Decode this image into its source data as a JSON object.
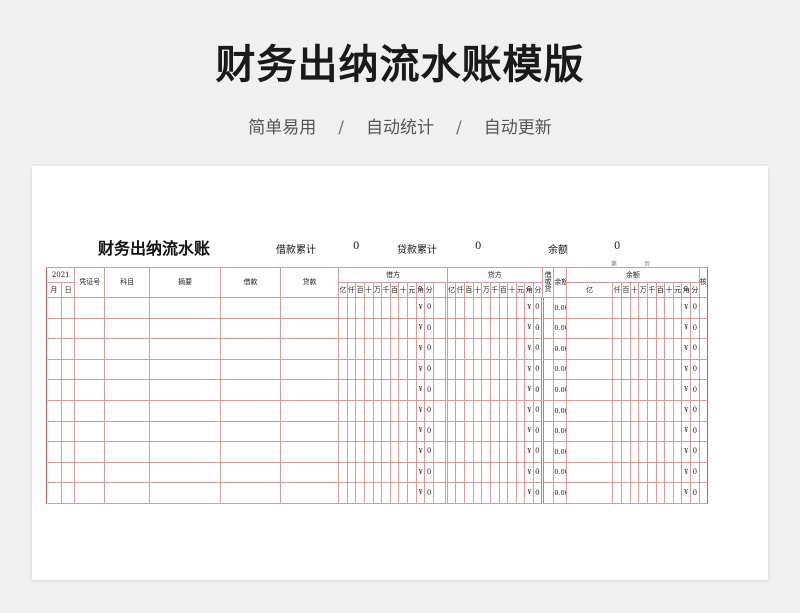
{
  "banner": {
    "title": "财务出纳流水账模版",
    "tags": [
      "简单易用",
      "自动统计",
      "自动更新"
    ],
    "separator": "/"
  },
  "sheet": {
    "title": "财务出纳流水账",
    "summary": {
      "debit_total_label": "借款累计",
      "debit_total_value": "0",
      "credit_total_label": "贷款累计",
      "credit_total_value": "0",
      "balance_label": "余额",
      "balance_value": "0"
    },
    "page_label": {
      "prefix": "第",
      "suffix": "页"
    }
  },
  "table": {
    "year": "2021",
    "month": "月",
    "day": "日",
    "voucher_no": "凭证号",
    "account": "科目",
    "summary": "摘要",
    "debit": "借款",
    "credit": "贷款",
    "debit_side": "借方",
    "credit_side": "贷方",
    "direction": [
      "借",
      "或",
      "贷"
    ],
    "balance": "余额",
    "balance_group": "余额",
    "check": "核对",
    "digit_units": [
      "亿",
      "仟",
      "百",
      "十",
      "万",
      "千",
      "百",
      "十",
      "元",
      "角",
      "分"
    ],
    "row_count": 10,
    "row_values": {
      "currency": "¥",
      "zero": "0",
      "balance": "0.00"
    }
  },
  "colors": {
    "grid": "#d79a9a",
    "background": "#f0f0f1"
  }
}
